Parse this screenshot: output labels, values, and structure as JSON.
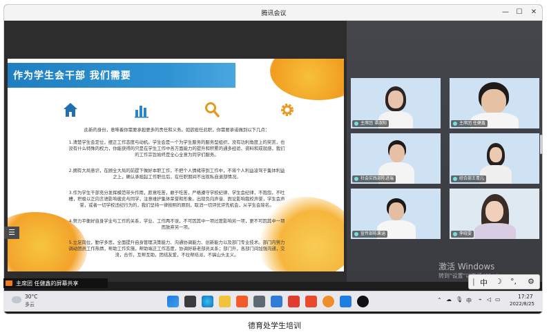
{
  "window": {
    "title": "腾讯会议"
  },
  "slide": {
    "title": "作为学生会干部 我们需要",
    "intro": "此新的身份，意味着你需要承担更多的责任和义务。如欲担任此职，你需要承诺做到以下几点：",
    "p1": [
      "1.清楚学生会定位，摆正工作态度与动机。学生会是一个为学生服务的服务型组织，没有功利角度上的奖赏，也",
      "没有什么特殊的权力，你能获得的只是在学生工作中各方面能力的提升和积累的通多经验、资料和成就感，我们",
      "的工作宗旨始终是全心全意为同学们服务。"
    ],
    "p2": [
      "2.拥有大局意识，在顾全大局的前提下做好本职工作，不把个人情绪带到工作中，不将个人利益凌驾于集体利益",
      "之上，确认承担起工作职位后，在任职期间不出现私自退部情况。"
    ],
    "p3": [
      "3.作为学生干部充分发挥模范带头作用，愿意吃苦，敢于吃苦，严格遵守学校纪律、学生会纪律，不抱怨，不吐",
      "槽，积极以正向言语影响彼此与同学，注意维护集体荣誉和形象。出现负向声音、舆论影响我校声誉，学生会声",
      "誉，或者一切学校违纪行为的，我们坚持一律按照的原则，取消一切评优评先机会，从学生会除名。"
    ],
    "p4": [
      "4.努力平衡好自身学业与工作的关系，学业、工作两不误，不可因其中一项过度影响另一项，更不可因其中一项",
      "而放弃另一项。"
    ],
    "p5": [
      "5.立足岗位，勤学多思，全面提升自身管理决策能力、沟通协调能力、创新能力以及部门专业技术。部门内努力",
      "调动团员工作热情，帮助工作实施，帮助端正工作态度，协调好新老部员关系；部门外，各部门间加强沟通，交",
      "流，合作，互帮互助，团结友爱，不拉帮结派，不搞山头主义。"
    ]
  },
  "participants": [
    {
      "name": "主席团 谭淑阳"
    },
    {
      "name": "主席团 任健鑫"
    },
    {
      "name": "社会实践部陈进瑞"
    },
    {
      "name": "综合部王青儿"
    },
    {
      "name": "宣传部陈秉涵"
    },
    {
      "name": "李晓雯"
    }
  ],
  "share_label": "主席团 任健鑫的屏幕共享",
  "watermark": {
    "line1": "激活 Windows",
    "line2": "转到\"设置\"以激活 Windows。"
  },
  "ime": {
    "mode": "中",
    "moon": "☽",
    "punct": "°,",
    "gear": "⚙"
  },
  "taskbar": {
    "weather_temp": "30°C",
    "weather_desc": "多云",
    "time": "17:27",
    "date": "2022/8/25",
    "tray_lang": "中"
  },
  "caption": "德育处学生培训",
  "colors": {
    "banner": "#1f7fc1",
    "accent": "#f5a623",
    "taskbar": "#e9e9ed"
  }
}
